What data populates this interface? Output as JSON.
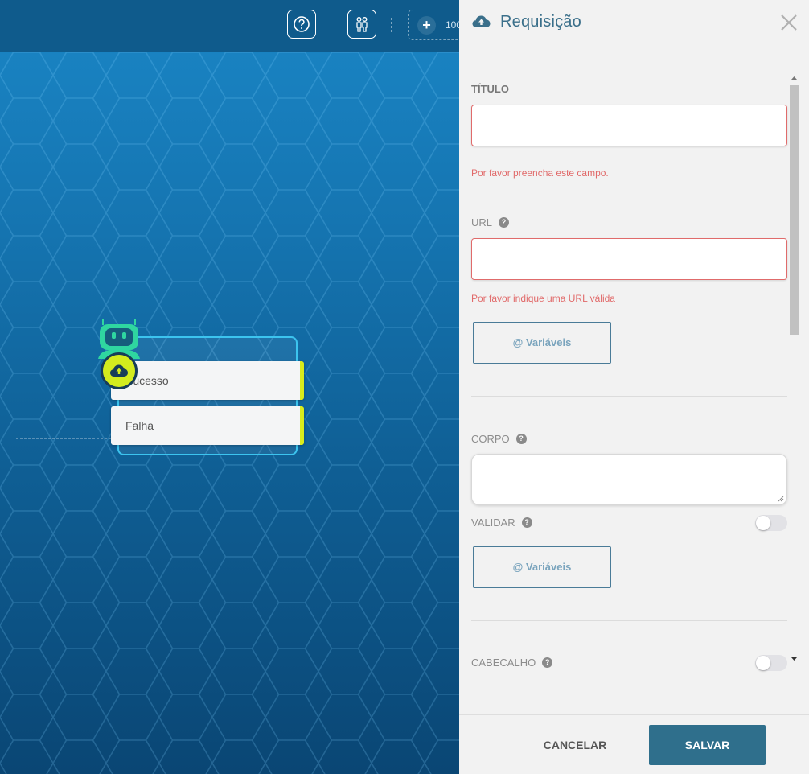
{
  "toolbar": {
    "zoom_level": "100"
  },
  "node": {
    "outputs": [
      {
        "label": "Sucesso"
      },
      {
        "label": "Falha"
      }
    ]
  },
  "panel": {
    "title": "Requisição",
    "title_icon": "cloud-upload-icon",
    "fields": {
      "titulo": {
        "label": "TÍTULO",
        "value": "",
        "error": "Por favor preencha este campo."
      },
      "url": {
        "label": "URL",
        "value": "",
        "error": "Por favor indique uma URL válida"
      },
      "url_variables_button": "@ Variáveis",
      "corpo": {
        "label": "CORPO",
        "value": ""
      },
      "validar": {
        "label": "VALIDAR",
        "enabled": false
      },
      "corpo_variables_button": "@ Variáveis",
      "cabecalho": {
        "label": "CABECALHO",
        "enabled": false
      }
    },
    "footer": {
      "cancel_label": "CANCELAR",
      "save_label": "SALVAR"
    }
  },
  "colors": {
    "accent": "#2f6f8c",
    "error": "#e16a6a",
    "node_highlight": "#d4ec1e"
  }
}
